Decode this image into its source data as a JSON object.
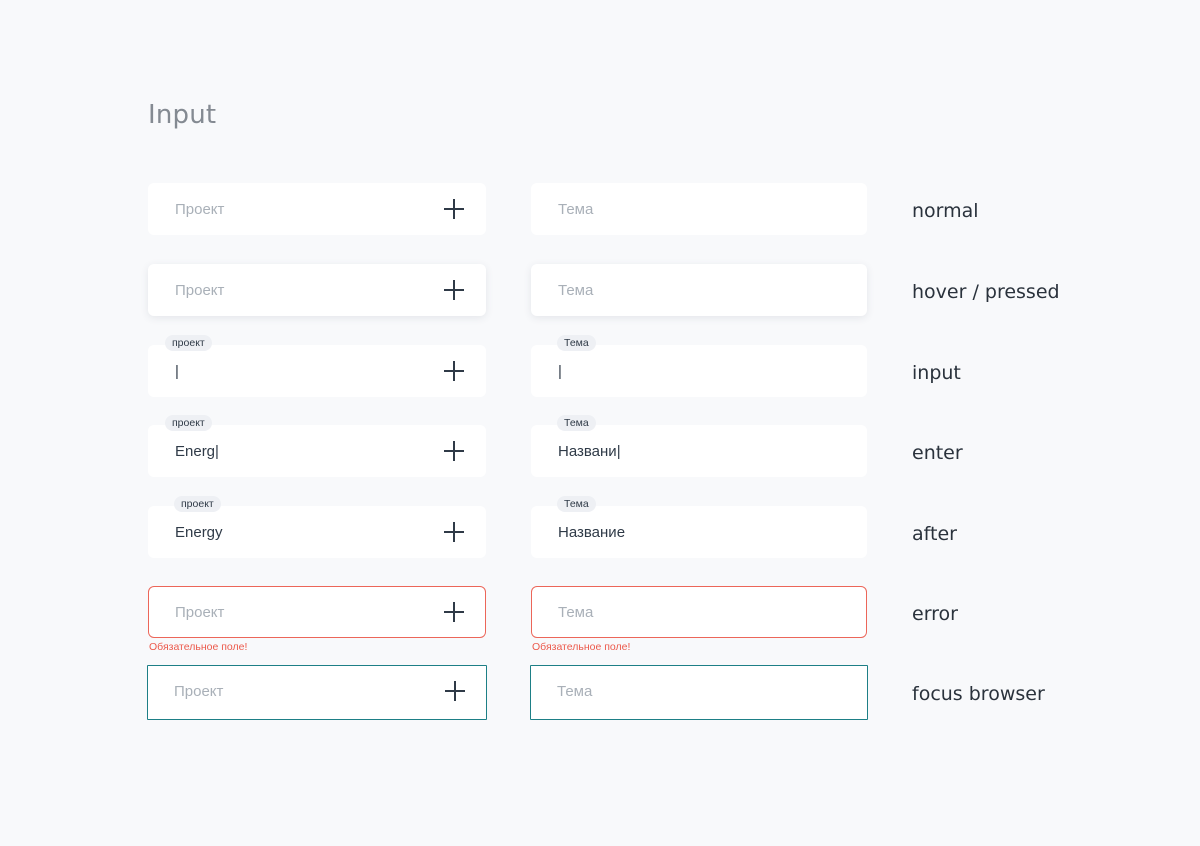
{
  "title": "Input",
  "colors": {
    "background": "#f8f9fb",
    "field": "#ffffff",
    "placeholder": "#a9b0b8",
    "text": "#2f3a47",
    "error": "#ec6659",
    "focus": "#1d7f86"
  },
  "icons": {
    "add": "plus-icon"
  },
  "rows": [
    {
      "state": "normal",
      "project": {
        "placeholder": "Проект",
        "value": "",
        "chip": ""
      },
      "topic": {
        "placeholder": "Тема",
        "value": "",
        "chip": ""
      }
    },
    {
      "state": "hover / pressed",
      "project": {
        "placeholder": "Проект",
        "value": "",
        "chip": ""
      },
      "topic": {
        "placeholder": "Тема",
        "value": "",
        "chip": ""
      }
    },
    {
      "state": "input",
      "project": {
        "placeholder": "",
        "value": "|",
        "chip": "проект"
      },
      "topic": {
        "placeholder": "",
        "value": "|",
        "chip": "Тема"
      }
    },
    {
      "state": "enter",
      "project": {
        "placeholder": "",
        "value": "Energ|",
        "chip": "проект"
      },
      "topic": {
        "placeholder": "",
        "value": "Названи|",
        "chip": "Тема"
      }
    },
    {
      "state": "after",
      "project": {
        "placeholder": "",
        "value": "Energy",
        "chip": "проект"
      },
      "topic": {
        "placeholder": "",
        "value": "Название",
        "chip": "Тема"
      }
    },
    {
      "state": "error",
      "project": {
        "placeholder": "Проект",
        "value": "",
        "chip": "",
        "error": "Обязательное поле!"
      },
      "topic": {
        "placeholder": "Тема",
        "value": "",
        "chip": "",
        "error": "Обязательное поле!"
      }
    },
    {
      "state": "focus browser",
      "project": {
        "placeholder": "Проект",
        "value": "",
        "chip": ""
      },
      "topic": {
        "placeholder": "Тема",
        "value": "",
        "chip": ""
      }
    }
  ]
}
